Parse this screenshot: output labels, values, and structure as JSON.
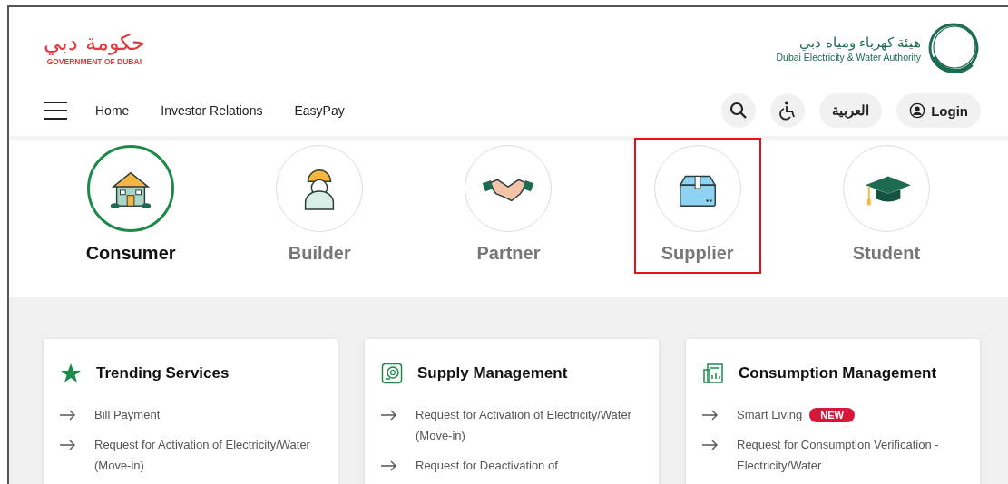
{
  "header": {
    "gov_logo": {
      "arabic": "حكومة دبي",
      "english": "GOVERNMENT OF DUBAI"
    },
    "dewa_logo": {
      "arabic": "هيئة كهرباء ومياه دبي",
      "english": "Dubai Electricity & Water Authority"
    }
  },
  "nav": {
    "links": [
      "Home",
      "Investor Relations",
      "EasyPay"
    ],
    "language": "العربية",
    "login": "Login"
  },
  "segments": [
    {
      "label": "Consumer",
      "kind": "house",
      "selected": true,
      "highlighted": false
    },
    {
      "label": "Builder",
      "kind": "worker",
      "selected": false,
      "highlighted": false
    },
    {
      "label": "Partner",
      "kind": "handshake",
      "selected": false,
      "highlighted": false
    },
    {
      "label": "Supplier",
      "kind": "box",
      "selected": false,
      "highlighted": true
    },
    {
      "label": "Student",
      "kind": "cap",
      "selected": false,
      "highlighted": false
    }
  ],
  "cards": [
    {
      "title": "Trending Services",
      "kind": "star",
      "items": [
        {
          "text": "Bill Payment"
        },
        {
          "text": "Request for Activation of Electricity/Water (Move-in)"
        }
      ]
    },
    {
      "title": "Supply Management",
      "kind": "supply",
      "items": [
        {
          "text": "Request for Activation of Electricity/Water (Move-in)"
        },
        {
          "text": "Request for Deactivation of"
        }
      ]
    },
    {
      "title": "Consumption Management",
      "kind": "meter",
      "items": [
        {
          "text": "Smart Living",
          "badge": "NEW"
        },
        {
          "text": "Request for Consumption Verification - Electricity/Water"
        }
      ]
    }
  ]
}
